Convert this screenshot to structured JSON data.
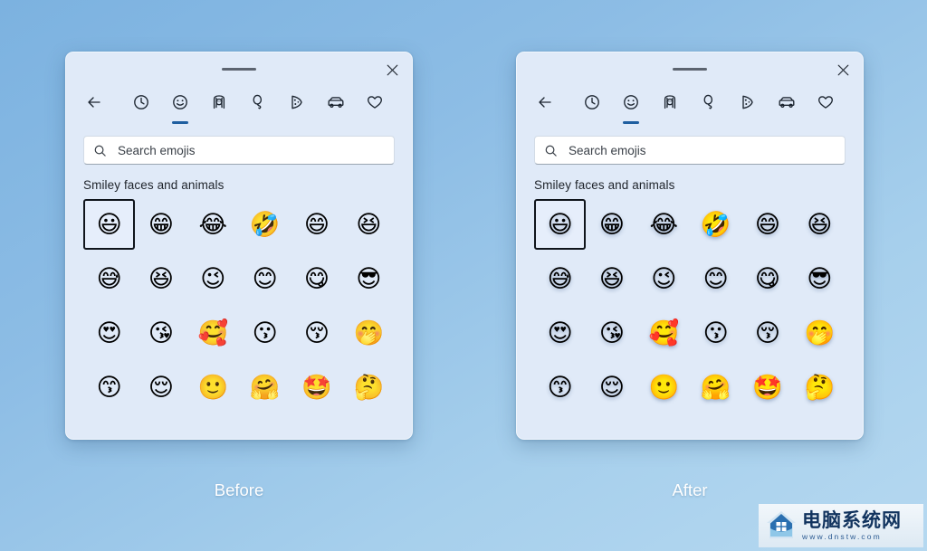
{
  "background": {
    "gradient_from": "#7cb2e0",
    "gradient_to": "#b5d8f0"
  },
  "panels": [
    {
      "id": "before",
      "caption": "Before",
      "titlebar": {
        "drag_handle": "drag-handle",
        "close_label": "Close"
      },
      "categories": [
        {
          "name": "back",
          "icon": "back-arrow-icon",
          "active": false
        },
        {
          "name": "recent",
          "icon": "clock-icon",
          "active": false
        },
        {
          "name": "emoji",
          "icon": "smiley-icon",
          "active": true
        },
        {
          "name": "gif",
          "icon": "person-icon",
          "active": false
        },
        {
          "name": "kaomoji",
          "icon": "balloon-icon",
          "active": false
        },
        {
          "name": "symbols",
          "icon": "pizza-icon",
          "active": false
        },
        {
          "name": "transport",
          "icon": "car-icon",
          "active": false
        },
        {
          "name": "favorites",
          "icon": "heart-icon",
          "active": false
        }
      ],
      "search": {
        "placeholder": "Search emojis",
        "value": "",
        "icon": "search-icon"
      },
      "section_title": "Smiley faces and animals",
      "style": "flat",
      "emoji_rows": [
        [
          "😃",
          "😁",
          "😂",
          "🤣",
          "😄",
          "😆"
        ],
        [
          "😅",
          "😆",
          "😉",
          "😊",
          "😋",
          "😎"
        ],
        [
          "😍",
          "😘",
          "🥰",
          "😗",
          "😚",
          "🤭"
        ],
        [
          "😙",
          "😌",
          "🙂",
          "🤗",
          "🤩",
          "🤔"
        ]
      ],
      "emoji_names": [
        [
          "grinning-big-eyes",
          "beaming-smiling-eyes",
          "tears-of-joy",
          "rolling-on-floor-laughing",
          "grinning-smiling-eyes",
          "grinning-squinting"
        ],
        [
          "grinning-sweat",
          "squinting-laugh",
          "winking-face",
          "smiling-eyes",
          "savoring-food",
          "sunglasses-face"
        ],
        [
          "heart-eyes",
          "blowing-kiss",
          "smiling-with-hearts",
          "kissing-face",
          "kissing-closed-eyes",
          "hand-over-mouth"
        ],
        [
          "kissing-smiling-eyes",
          "relieved-face",
          "slight-smile",
          "hugging-face",
          "star-struck",
          "thinking-face"
        ]
      ],
      "selected_index": [
        0,
        0
      ]
    },
    {
      "id": "after",
      "caption": "After",
      "titlebar": {
        "drag_handle": "drag-handle",
        "close_label": "Close"
      },
      "categories": [
        {
          "name": "back",
          "icon": "back-arrow-icon",
          "active": false
        },
        {
          "name": "recent",
          "icon": "clock-icon",
          "active": false
        },
        {
          "name": "emoji",
          "icon": "smiley-icon",
          "active": true
        },
        {
          "name": "gif",
          "icon": "person-icon",
          "active": false
        },
        {
          "name": "kaomoji",
          "icon": "balloon-icon",
          "active": false
        },
        {
          "name": "symbols",
          "icon": "pizza-icon",
          "active": false
        },
        {
          "name": "transport",
          "icon": "car-icon",
          "active": false
        },
        {
          "name": "favorites",
          "icon": "heart-icon",
          "active": false
        }
      ],
      "search": {
        "placeholder": "Search emojis",
        "value": "",
        "icon": "search-icon"
      },
      "section_title": "Smiley faces and animals",
      "style": "three-dimensional",
      "emoji_rows": [
        [
          "😃",
          "😁",
          "😂",
          "🤣",
          "😄",
          "😆"
        ],
        [
          "😅",
          "😆",
          "😉",
          "😊",
          "😋",
          "😎"
        ],
        [
          "😍",
          "😘",
          "🥰",
          "😗",
          "😚",
          "🤭"
        ],
        [
          "😙",
          "😌",
          "🙂",
          "🤗",
          "🤩",
          "🤔"
        ]
      ],
      "emoji_names": [
        [
          "grinning-big-eyes",
          "beaming-smiling-eyes",
          "tears-of-joy",
          "rolling-on-floor-laughing",
          "grinning-smiling-eyes",
          "grinning-squinting"
        ],
        [
          "grinning-sweat",
          "squinting-laugh",
          "winking-face",
          "smiling-eyes",
          "savoring-food",
          "sunglasses-face"
        ],
        [
          "heart-eyes",
          "blowing-kiss",
          "smiling-with-hearts",
          "kissing-face",
          "kissing-closed-eyes",
          "hand-over-mouth"
        ],
        [
          "kissing-smiling-eyes",
          "relieved-face",
          "slight-smile",
          "hugging-face",
          "star-struck",
          "thinking-face"
        ]
      ],
      "selected_index": [
        0,
        0
      ]
    }
  ],
  "watermark": {
    "title_cn": "电脑系统网",
    "url": "www.dnstw.com",
    "logo": "house-shield-logo"
  },
  "colors": {
    "panel_bg": "#e0eaf8",
    "accent_underline": "#1f5fa0",
    "selection_border": "#10151c",
    "search_bg": "#ffffff",
    "text": "#1e232a"
  }
}
